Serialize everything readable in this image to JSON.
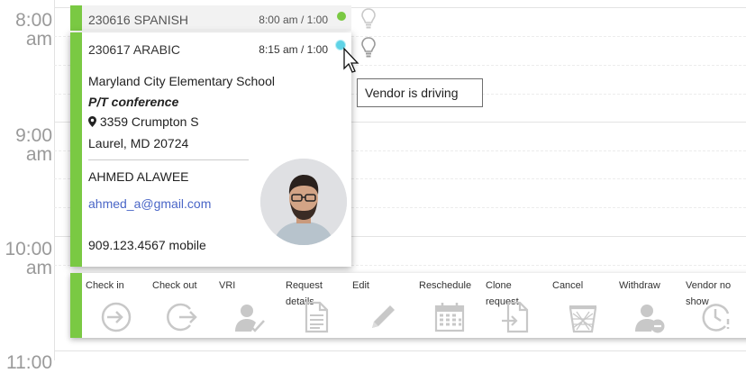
{
  "times": [
    {
      "hour": "8:00",
      "suffix": "am"
    },
    {
      "hour": "9:00",
      "suffix": "am"
    },
    {
      "hour": "10:00",
      "suffix": "am"
    },
    {
      "hour": "11:00",
      "suffix": ""
    }
  ],
  "appointment_top": {
    "id_language": "230616  SPANISH",
    "time": "8:00 am / 1:00",
    "status_color": "#7ac943"
  },
  "popup": {
    "id_language": "230617  ARABIC",
    "time": "8:15 am / 1:00",
    "status_color": "#5fd3e6",
    "school": "Maryland City Elementary School",
    "event": "P/T conference",
    "street": "3359 Crumpton S",
    "city": "Laurel, MD 20724",
    "contact_name": "AHMED ALAWEE",
    "email": "ahmed_a@gmail.com",
    "phone": "909.123.4567 mobile",
    "accent_color": "#7ac943"
  },
  "tooltip": {
    "text": "Vendor is driving"
  },
  "toolbar": {
    "actions": [
      {
        "label": "Check in",
        "icon": "check-in-icon"
      },
      {
        "label": "Check out",
        "icon": "check-out-icon"
      },
      {
        "label": "VRI",
        "icon": "user-check-icon"
      },
      {
        "label": "Request details",
        "icon": "document-icon"
      },
      {
        "label": "Edit",
        "icon": "pencil-icon"
      },
      {
        "label": "Reschedule",
        "icon": "calendar-icon"
      },
      {
        "label": "Clone request",
        "icon": "clone-icon"
      },
      {
        "label": "Cancel",
        "icon": "trash-icon"
      },
      {
        "label": "Withdraw",
        "icon": "user-minus-icon"
      },
      {
        "label": "Vendor no show",
        "icon": "clock-icon"
      }
    ]
  }
}
